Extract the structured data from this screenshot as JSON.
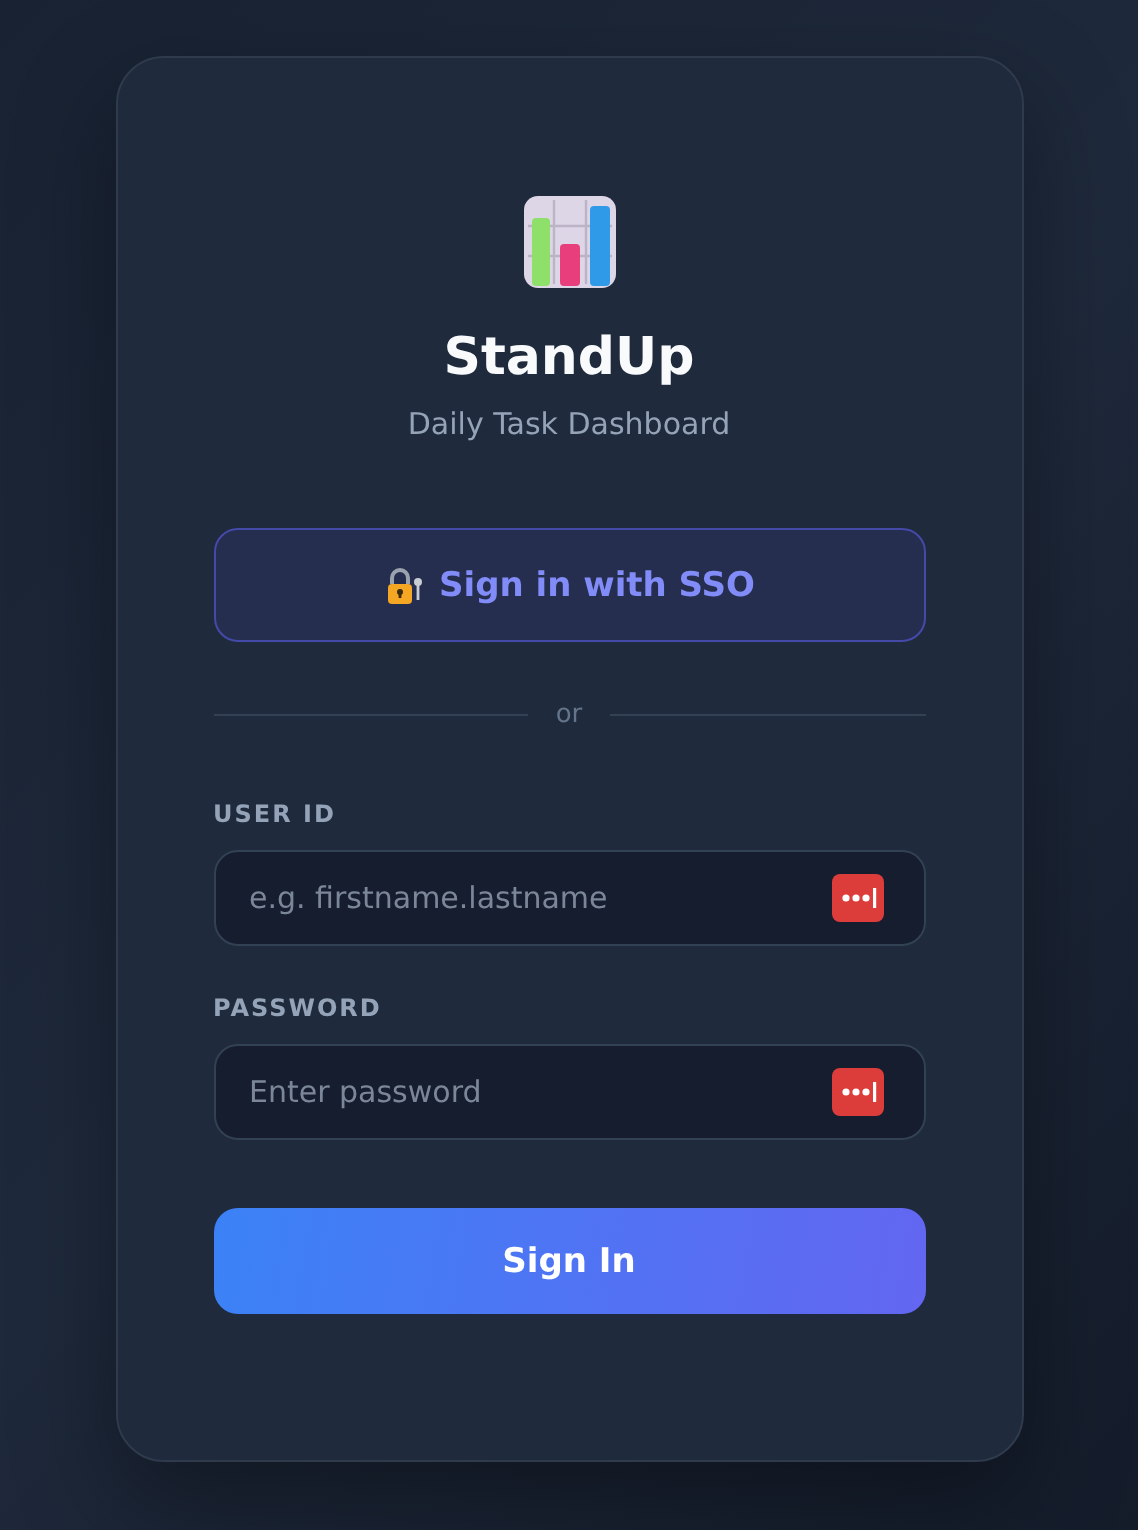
{
  "app": {
    "title": "StandUp",
    "subtitle": "Daily Task Dashboard"
  },
  "sso_button": {
    "label": "Sign in with SSO"
  },
  "divider": {
    "label": "or"
  },
  "fields": [
    {
      "label": "USER ID",
      "placeholder": "e.g. firstname.lastname"
    },
    {
      "label": "PASSWORD",
      "placeholder": "Enter password"
    }
  ],
  "submit_button": {
    "label": "Sign In"
  }
}
